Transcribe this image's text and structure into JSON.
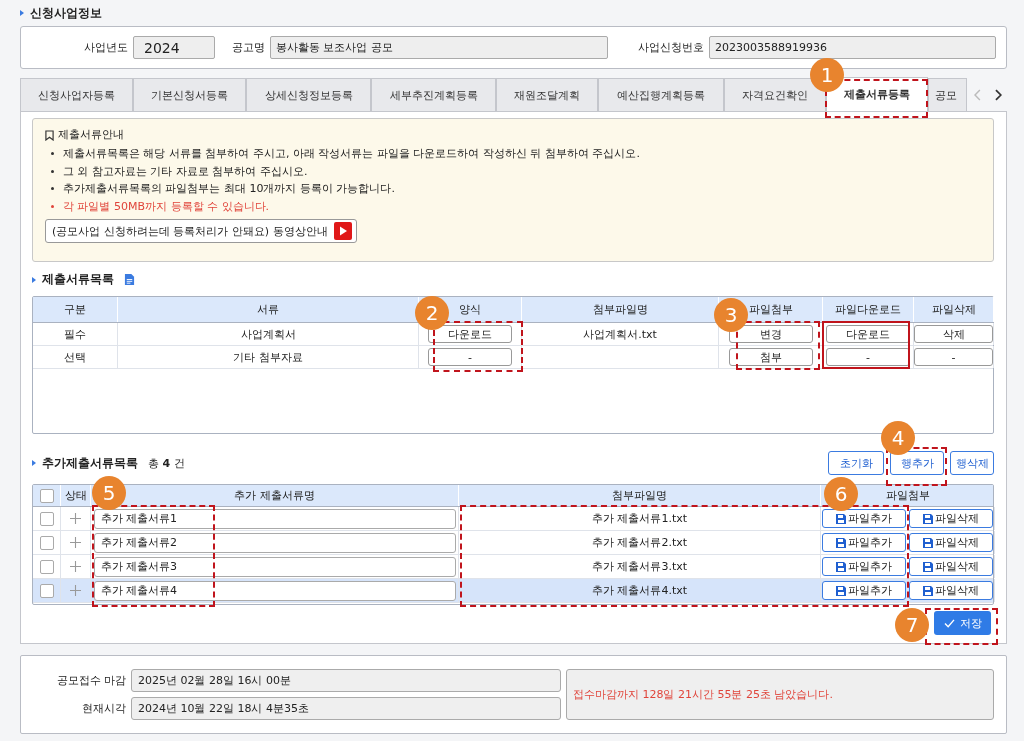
{
  "section_title": "신청사업정보",
  "info": {
    "year_label": "사업년도",
    "year": "2024",
    "notice_label": "공고명",
    "notice": "봉사활동 보조사업 공모",
    "number_label": "사업신청번호",
    "number": "2023003588919936"
  },
  "tabs": [
    {
      "label": "신청사업자등록",
      "selected": false
    },
    {
      "label": "기본신청서등록",
      "selected": false
    },
    {
      "label": "상세신청정보등록",
      "selected": false
    },
    {
      "label": "세부추진계획등록",
      "selected": false
    },
    {
      "label": "재원조달계획",
      "selected": false
    },
    {
      "label": "예산집행계획등록",
      "selected": false
    },
    {
      "label": "자격요건확인",
      "selected": false
    },
    {
      "label": "제출서류등록",
      "selected": true
    },
    {
      "label": "공모",
      "selected": false
    }
  ],
  "guide": {
    "title": "제출서류안내",
    "bullets": [
      {
        "text": "제출서류목록은 해당 서류를 첨부하여 주시고, 아래 작성서류는 파일을 다운로드하여 작성하신 뒤 첨부하여 주십시오.",
        "kind": "normal"
      },
      {
        "text": "그 외 참고자료는 기타 자료로 첨부하여 주십시오.",
        "kind": "normal"
      },
      {
        "text": "추가제출서류목록의 파일첨부는 최대 10개까지 등록이 가능합니다.",
        "kind": "normal"
      },
      {
        "text": "각 파일별 50MB까지 등록할 수 있습니다.",
        "kind": "warning"
      }
    ],
    "video_button": "(공모사업 신청하려는데 등록처리가 안돼요) 동영상안내"
  },
  "documents": {
    "title": "제출서류목록",
    "columns": [
      "구분",
      "서류",
      "양식",
      "첨부파일명",
      "파일첨부",
      "파일다운로드",
      "파일삭제"
    ],
    "rows": [
      {
        "category": "필수",
        "document": "사업계획서",
        "form_button": "다운로드",
        "file_name": "사업계획서.txt",
        "attach_button": "변경",
        "download_button": "다운로드",
        "delete_button": "삭제"
      },
      {
        "category": "선택",
        "document": "기타 첨부자료",
        "form_button": "-",
        "attach_button": "첨부",
        "download_button": "-",
        "delete_button": "-"
      }
    ]
  },
  "extra_documents": {
    "title": "추가제출서류목록",
    "count_prefix": "총",
    "count": "4",
    "count_suffix": "건",
    "buttons": [
      "초기화",
      "행추가",
      "행삭제"
    ],
    "all_checked": false,
    "columns": [
      "상태",
      "추가 제출서류명",
      "첨부파일명",
      "파일첨부"
    ],
    "rows": [
      {
        "checked": false,
        "selected": false,
        "name": "추가 제출서류1",
        "file_name": "추가 제출서류1.txt",
        "add_button": "파일추가",
        "delete_button": "파일삭제"
      },
      {
        "checked": false,
        "selected": false,
        "name": "추가 제출서류2",
        "file_name": "추가 제출서류2.txt",
        "add_button": "파일추가",
        "delete_button": "파일삭제"
      },
      {
        "checked": false,
        "selected": false,
        "name": "추가 제출서류3",
        "file_name": "추가 제출서류3.txt",
        "add_button": "파일추가",
        "delete_button": "파일삭제"
      },
      {
        "checked": false,
        "selected": true,
        "name": "추가 제출서류4",
        "file_name": "추가 제출서류4.txt",
        "add_button": "파일추가",
        "delete_button": "파일삭제"
      }
    ],
    "save_button": "저장"
  },
  "deadline": {
    "deadline_label": "공모접수 마감",
    "deadline": "2025년 02월 28일 16시 00분",
    "now_label": "현재시각",
    "now": "2024년 10월 22일 18시 4분35초",
    "message": "접수마감까지 128일 21시간 55분 25초 남았습니다."
  },
  "callouts": [
    {
      "number": "1",
      "dashed": true
    },
    {
      "number": "2",
      "dashed": true
    },
    {
      "number": "3",
      "dashed": true
    },
    {
      "number": "4",
      "dashed": true
    },
    {
      "number": "5",
      "dashed": true
    },
    {
      "number": "6",
      "dashed": true
    },
    {
      "number": "7",
      "dashed": true
    }
  ],
  "extra_frames": [
    {
      "dashed": false
    }
  ]
}
